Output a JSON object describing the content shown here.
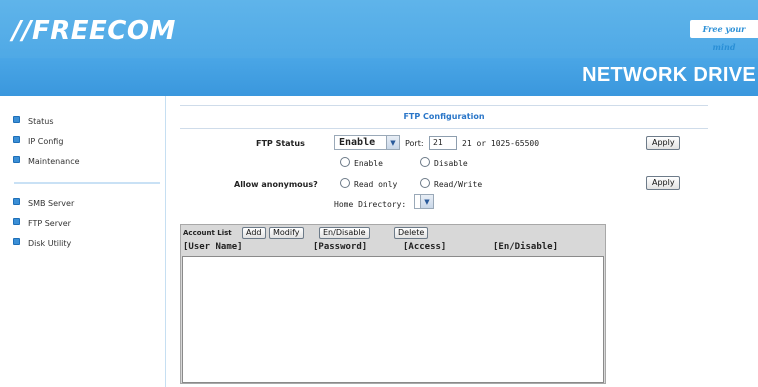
{
  "header": {
    "logo": "//FREECOM",
    "tagline": "Free your mind",
    "product_title": "NETWORK DRIVE"
  },
  "sidebar": {
    "items_top": [
      {
        "label": "Status"
      },
      {
        "label": "IP Config"
      },
      {
        "label": "Maintenance"
      }
    ],
    "items_bottom": [
      {
        "label": "SMB Server"
      },
      {
        "label": "FTP Server"
      },
      {
        "label": "Disk Utility"
      }
    ]
  },
  "main": {
    "section_title": "FTP Configuration",
    "ftp_status": {
      "label": "FTP Status",
      "value": "Enable",
      "port_label": "Port:",
      "port_value": "21",
      "port_hint": "21 or 1025-65500",
      "apply_label": "Apply"
    },
    "anonymous": {
      "label": "Allow anonymous?",
      "option_enable": "Enable",
      "option_disable": "Disable",
      "option_read_only": "Read only",
      "option_read_write": "Read/Write",
      "home_dir_label": "Home Directory:",
      "home_dir_value": "",
      "apply_label": "Apply"
    },
    "account_list": {
      "label": "Account List",
      "add_label": "Add",
      "modify_label": "Modify",
      "en_disable_label": "En/Disable",
      "delete_label": "Delete",
      "columns": [
        "[User Name]",
        "[Password]",
        "[Access]",
        "[En/Disable]"
      ],
      "rows": []
    }
  }
}
